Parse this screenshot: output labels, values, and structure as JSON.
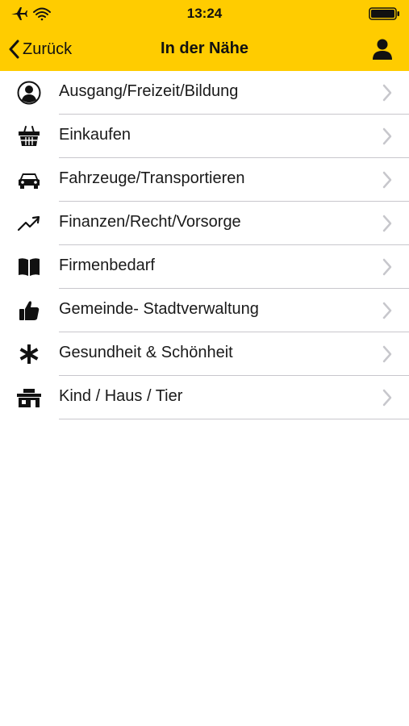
{
  "status_bar": {
    "time": "13:24",
    "icons": [
      "airplane-icon",
      "wifi-icon",
      "battery-icon"
    ]
  },
  "nav": {
    "back_label": "Zurück",
    "title": "In der Nähe",
    "profile_icon": "person-icon"
  },
  "colors": {
    "header_background": "#ffcc00",
    "text": "#111111",
    "divider": "#c8c7cc",
    "chevron": "#c7c7cc"
  },
  "categories": [
    {
      "label": "Ausgang/Freizeit/Bildung",
      "icon": "person-circle-icon"
    },
    {
      "label": "Einkaufen",
      "icon": "shopping-basket-icon"
    },
    {
      "label": "Fahrzeuge/Transportieren",
      "icon": "car-icon"
    },
    {
      "label": "Finanzen/Recht/Vorsorge",
      "icon": "trend-up-icon"
    },
    {
      "label": "Firmenbedarf",
      "icon": "open-book-icon"
    },
    {
      "label": "Gemeinde- Stadtverwaltung",
      "icon": "thumbs-up-icon"
    },
    {
      "label": "Gesundheit & Schönheit",
      "icon": "asterisk-icon"
    },
    {
      "label": "Kind / Haus / Tier",
      "icon": "house-icon"
    }
  ]
}
